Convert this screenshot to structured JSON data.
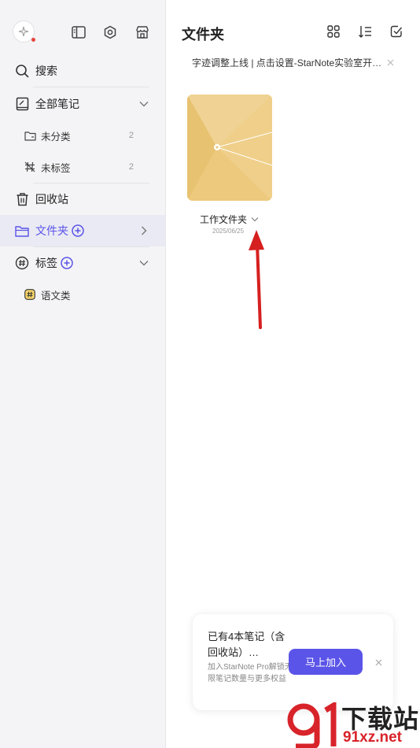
{
  "sidebar": {
    "search_label": "搜索",
    "all_notes_label": "全部笔记",
    "uncategorized_label": "未分类",
    "uncategorized_count": "2",
    "untagged_label": "未标签",
    "untagged_count": "2",
    "trash_label": "回收站",
    "folders_label": "文件夹",
    "tags_label": "标签",
    "tag_item_label": "语文类"
  },
  "main": {
    "title": "文件夹",
    "notice": "字迹调整上线 | 点击设置-StarNote实验室开…",
    "folder": {
      "name": "工作文件夹",
      "date": "2025/06/25"
    }
  },
  "promo": {
    "title": "已有4本笔记（含回收站）…",
    "description": "加入StarNote Pro解锁无限笔记数量与更多权益",
    "button_label": "马上加入"
  },
  "watermark": {
    "text": "下载站",
    "url": "91xz.net"
  },
  "colors": {
    "accent": "#5b54e8",
    "folder": "#ecc97d",
    "arrow": "#d62020"
  }
}
